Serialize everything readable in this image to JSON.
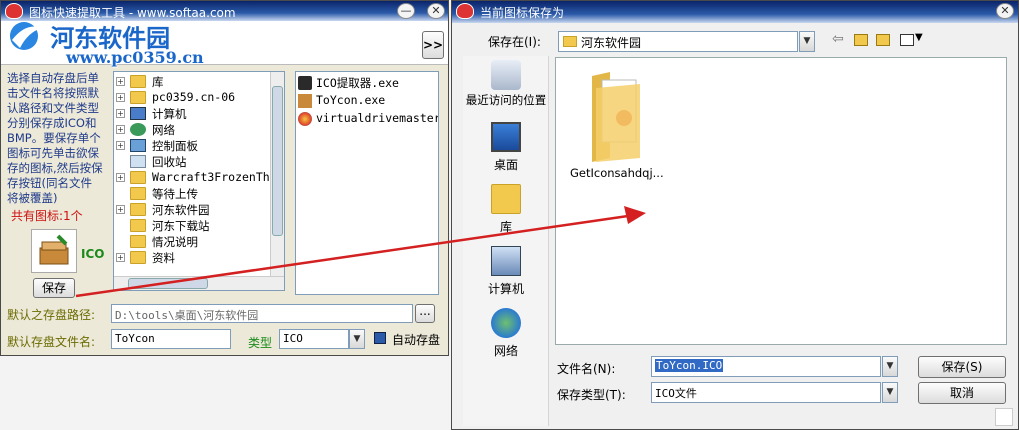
{
  "watermark": {
    "site": "河东软件园",
    "url": "www.pc0359.cn"
  },
  "left_window": {
    "title": "图标快速提取工具 - www.softaa.com",
    "expand_label": ">>",
    "help_text": "选择自动存盘后单击文件名将按照默认路径和文件类型分别保存成ICO和BMP。要保存单个图标可先单击欲保存的图标,然后按保存按钮(同名文件将被覆盖)",
    "icon_count": "共有图标:1个",
    "ico_tag": "ICO",
    "save_button": "保存",
    "tree": [
      {
        "label": "库",
        "expander": "+"
      },
      {
        "label": "pc0359.cn-06",
        "expander": "+"
      },
      {
        "label": "计算机",
        "expander": "+"
      },
      {
        "label": "网络",
        "expander": "+"
      },
      {
        "label": "控制面板",
        "expander": "+"
      },
      {
        "label": "回收站",
        "expander": ""
      },
      {
        "label": "Warcraft3FrozenTh",
        "expander": "+"
      },
      {
        "label": "等待上传",
        "expander": ""
      },
      {
        "label": "河东软件园",
        "expander": "+"
      },
      {
        "label": "河东下载站",
        "expander": ""
      },
      {
        "label": "情况说明",
        "expander": ""
      },
      {
        "label": "资料",
        "expander": "+"
      }
    ],
    "files": [
      "ICO提取器.exe",
      "ToYcon.exe",
      "virtualdrivemaster"
    ],
    "default_path_label": "默认之存盘路径:",
    "default_path_value": "D:\\tools\\桌面\\河东软件园",
    "browse_button": "...",
    "filename_label": "默认存盘文件名:",
    "filename_value": "ToYcon",
    "type_label": "类型",
    "type_value": "ICO",
    "autosave_label": "自动存盘"
  },
  "save_dialog": {
    "title": "当前图标保存为",
    "save_in_label": "保存在(I):",
    "save_in_value": "河东软件园",
    "places": [
      "最近访问的位置",
      "桌面",
      "库",
      "计算机",
      "网络"
    ],
    "folder_item": "GetIconsahdqj...",
    "filename_label": "文件名(N):",
    "filename_value": "ToYcon.ICO",
    "filetype_label": "保存类型(T):",
    "filetype_value": "ICO文件",
    "save_button": "保存(S)",
    "cancel_button": "取消"
  },
  "colors": {
    "arrow": "#d42020",
    "selection": "#316ac5"
  }
}
